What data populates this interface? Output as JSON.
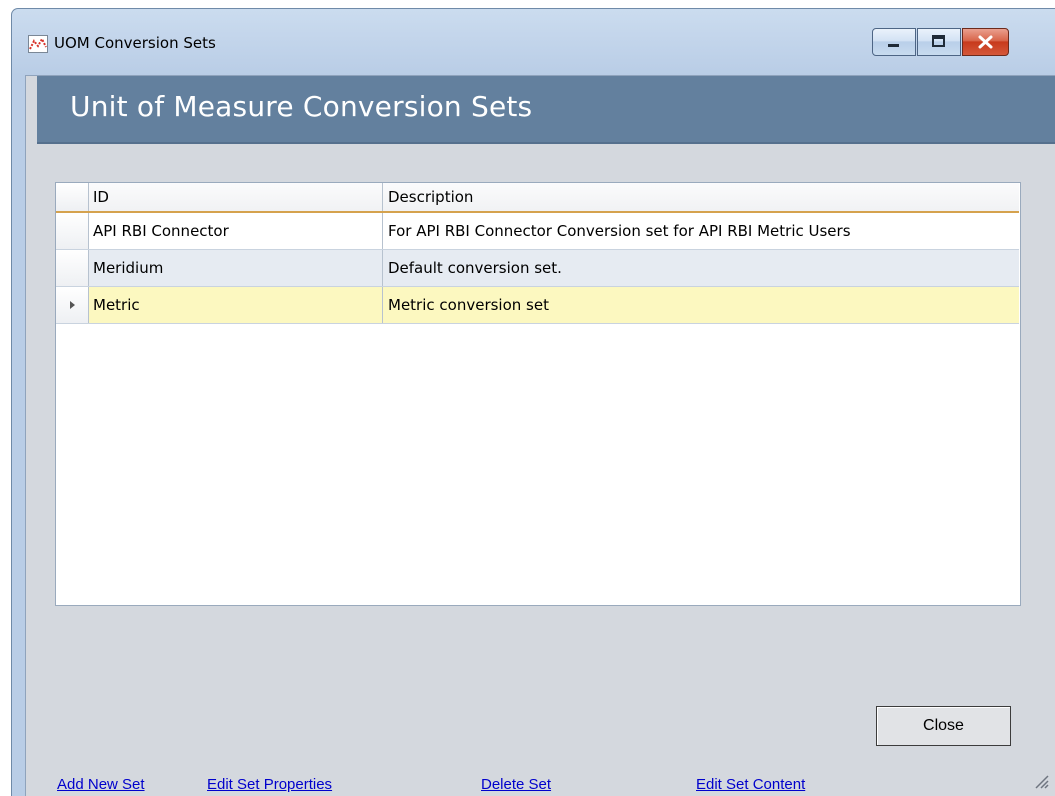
{
  "window": {
    "title": "UOM Conversion Sets",
    "controls": {
      "minimize": "minimize-icon",
      "maximize": "maximize-icon",
      "close": "close-icon"
    }
  },
  "header": {
    "title": "Unit of Measure Conversion Sets"
  },
  "grid": {
    "columns": [
      "ID",
      "Description"
    ],
    "rows": [
      {
        "id": "API RBI Connector",
        "description": "For API RBI Connector Conversion set for API RBI Metric Users"
      },
      {
        "id": "Meridium",
        "description": "Default conversion set."
      },
      {
        "id": "Metric",
        "description": "Metric conversion set"
      }
    ],
    "selected_row": 3
  },
  "actions": {
    "add": "Add New Set",
    "edit_properties": "Edit Set Properties",
    "delete": "Delete Set",
    "edit_content": "Edit Set Content",
    "close": "Close"
  },
  "colors": {
    "header_band": "#63809e",
    "selected_row": "#fcf8c0",
    "alt_row": "#e6ebf2",
    "link": "#0000cc"
  }
}
